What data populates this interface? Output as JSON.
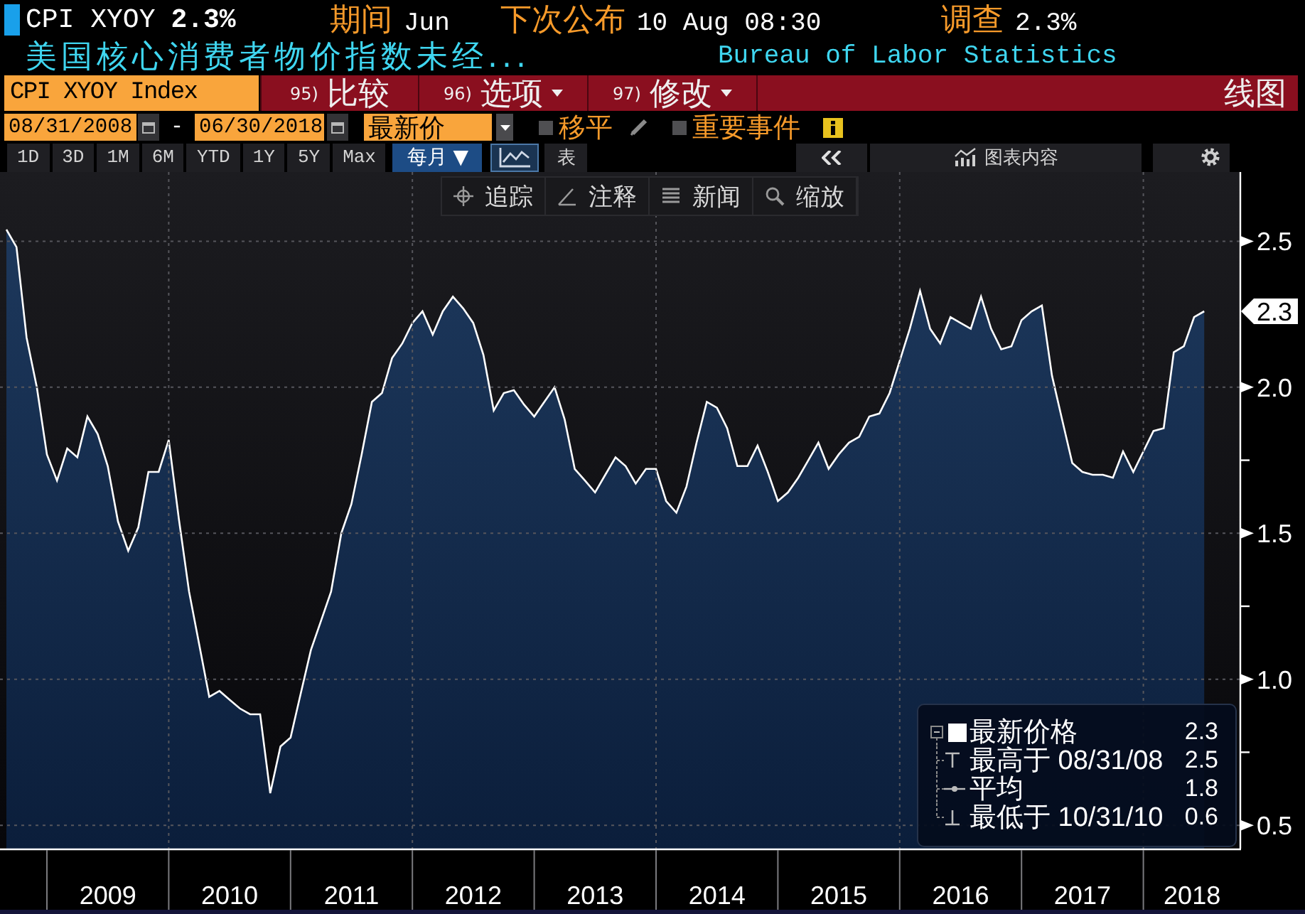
{
  "header": {
    "ticker": "CPI XYOY",
    "value": "2.3%",
    "fields": [
      {
        "label": "期间",
        "value": "Jun"
      },
      {
        "label": "下次公布",
        "value": "10 Aug 08:30"
      },
      {
        "label": "调查",
        "value": "2.3%"
      }
    ]
  },
  "subtitle": {
    "description": "美国核心消费者物价指数未经...",
    "source": "Bureau of Labor Statistics"
  },
  "command_bar": {
    "security": "CPI XYOY Index",
    "menus": [
      {
        "number": "95)",
        "label": "比较",
        "dropdown": false
      },
      {
        "number": "96)",
        "label": "选项",
        "dropdown": true
      },
      {
        "number": "97)",
        "label": "修改",
        "dropdown": true
      }
    ],
    "chart_type": "线图"
  },
  "controls": {
    "start_date": "08/31/2008",
    "separator": "-",
    "end_date": "06/30/2018",
    "price_field": "最新价",
    "options": [
      {
        "label": "移平",
        "checked": false
      },
      {
        "label": "重要事件",
        "checked": false
      }
    ]
  },
  "toolbar": {
    "periods": [
      {
        "label": "1D",
        "selected": false
      },
      {
        "label": "3D",
        "selected": false
      },
      {
        "label": "1M",
        "selected": false
      },
      {
        "label": "6M",
        "selected": false
      },
      {
        "label": "YTD",
        "selected": false
      },
      {
        "label": "1Y",
        "selected": false
      },
      {
        "label": "5Y",
        "selected": false
      },
      {
        "label": "Max",
        "selected": false
      }
    ],
    "frequency": "每月 ▼",
    "views": [
      {
        "kind": "chart",
        "selected": true
      },
      {
        "kind": "table",
        "label": "表",
        "selected": false
      }
    ],
    "chart_contents": "图表内容"
  },
  "chart_tools": [
    {
      "kind": "crosshair",
      "label": "追踪"
    },
    {
      "kind": "annotate",
      "label": "注释"
    },
    {
      "kind": "news",
      "label": "新闻"
    },
    {
      "kind": "zoom",
      "label": "缩放"
    }
  ],
  "chart": {
    "last_value_label": "2.3",
    "legend": [
      {
        "kind": "last",
        "value": "2.3"
      },
      {
        "kind": "high",
        "label": "最高于 08/31/08",
        "value": "2.5"
      },
      {
        "kind": "average",
        "label": "平均",
        "value": "1.8"
      },
      {
        "kind": "low",
        "label": "最低于 10/31/10",
        "value": "0.6"
      }
    ],
    "chart_data": {
      "type": "area",
      "grid": true,
      "x": [
        2008.667,
        2008.75,
        2008.833,
        2008.917,
        2009,
        2009.083,
        2009.167,
        2009.25,
        2009.333,
        2009.417,
        2009.5,
        2009.583,
        2009.667,
        2009.75,
        2009.833,
        2009.917,
        2010,
        2010.083,
        2010.167,
        2010.25,
        2010.333,
        2010.417,
        2010.5,
        2010.583,
        2010.667,
        2010.75,
        2010.833,
        2010.917,
        2011,
        2011.083,
        2011.167,
        2011.25,
        2011.333,
        2011.417,
        2011.5,
        2011.583,
        2011.667,
        2011.75,
        2011.833,
        2011.917,
        2012,
        2012.083,
        2012.167,
        2012.25,
        2012.333,
        2012.417,
        2012.5,
        2012.583,
        2012.667,
        2012.75,
        2012.833,
        2012.917,
        2013,
        2013.083,
        2013.167,
        2013.25,
        2013.333,
        2013.417,
        2013.5,
        2013.583,
        2013.667,
        2013.75,
        2013.833,
        2013.917,
        2014,
        2014.083,
        2014.167,
        2014.25,
        2014.333,
        2014.417,
        2014.5,
        2014.583,
        2014.667,
        2014.75,
        2014.833,
        2014.917,
        2015,
        2015.083,
        2015.167,
        2015.25,
        2015.333,
        2015.417,
        2015.5,
        2015.583,
        2015.667,
        2015.75,
        2015.833,
        2015.917,
        2016,
        2016.083,
        2016.167,
        2016.25,
        2016.333,
        2016.417,
        2016.5,
        2016.583,
        2016.667,
        2016.75,
        2016.833,
        2016.917,
        2017,
        2017.083,
        2017.167,
        2017.25,
        2017.333,
        2017.417,
        2017.5,
        2017.583,
        2017.667,
        2017.75,
        2017.833,
        2017.917,
        2018,
        2018.083,
        2018.167,
        2018.25,
        2018.333,
        2018.417,
        2018.5
      ],
      "series": [
        {
          "name": "最新价格",
          "color": "#ffffff",
          "values": [
            2.54,
            2.48,
            2.17,
            2.0,
            1.77,
            1.68,
            1.79,
            1.76,
            1.9,
            1.84,
            1.73,
            1.54,
            1.44,
            1.52,
            1.71,
            1.71,
            1.82,
            1.55,
            1.3,
            1.12,
            0.94,
            0.96,
            0.93,
            0.9,
            0.88,
            0.88,
            0.61,
            0.77,
            0.8,
            0.95,
            1.1,
            1.2,
            1.3,
            1.5,
            1.6,
            1.77,
            1.95,
            1.98,
            2.1,
            2.15,
            2.22,
            2.26,
            2.18,
            2.26,
            2.31,
            2.27,
            2.22,
            2.11,
            1.92,
            1.98,
            1.99,
            1.94,
            1.9,
            1.95,
            2.0,
            1.89,
            1.72,
            1.68,
            1.64,
            1.7,
            1.76,
            1.73,
            1.67,
            1.72,
            1.72,
            1.61,
            1.57,
            1.66,
            1.81,
            1.95,
            1.93,
            1.86,
            1.73,
            1.73,
            1.8,
            1.71,
            1.61,
            1.64,
            1.69,
            1.75,
            1.81,
            1.72,
            1.77,
            1.81,
            1.83,
            1.9,
            1.91,
            1.98,
            2.09,
            2.2,
            2.33,
            2.2,
            2.15,
            2.24,
            2.22,
            2.2,
            2.31,
            2.2,
            2.13,
            2.14,
            2.23,
            2.26,
            2.28,
            2.04,
            1.89,
            1.74,
            1.71,
            1.7,
            1.7,
            1.69,
            1.78,
            1.71,
            1.78,
            1.85,
            1.86,
            2.12,
            2.14,
            2.24,
            2.26
          ]
        }
      ],
      "xlim": [
        2008.615,
        2018.79
      ],
      "ylim": [
        0.42,
        2.737
      ],
      "xticks": [
        {
          "value": 2009.5,
          "label": "2009"
        },
        {
          "value": 2010.5,
          "label": "2010"
        },
        {
          "value": 2011.5,
          "label": "2011"
        },
        {
          "value": 2012.5,
          "label": "2012"
        },
        {
          "value": 2013.5,
          "label": "2013"
        },
        {
          "value": 2014.5,
          "label": "2014"
        },
        {
          "value": 2015.5,
          "label": "2015"
        },
        {
          "value": 2016.5,
          "label": "2016"
        },
        {
          "value": 2017.5,
          "label": "2017"
        },
        {
          "value": 2018.4,
          "label": "2018"
        }
      ],
      "yticks": [
        {
          "value": 0.5,
          "label": "0.5"
        },
        {
          "value": 1,
          "label": "1.0"
        },
        {
          "value": 1.5,
          "label": "1.5"
        },
        {
          "value": 2,
          "label": "2.0"
        },
        {
          "value": 2.5,
          "label": "2.5"
        }
      ]
    }
  }
}
